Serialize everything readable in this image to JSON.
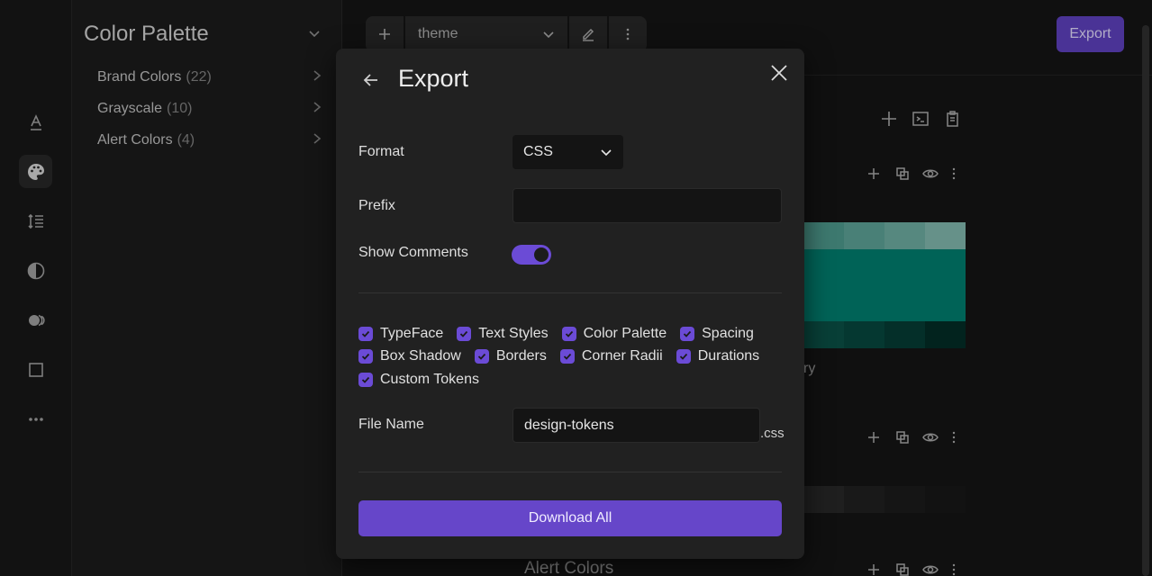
{
  "rail": {
    "icons": [
      "typography-icon",
      "palette-icon",
      "line-height-icon",
      "contrast-icon",
      "shadow-icon",
      "border-square-icon",
      "more-horizontal-icon"
    ]
  },
  "sidebar": {
    "title": "Color Palette",
    "items": [
      {
        "label": "Brand Colors",
        "count": "(22)"
      },
      {
        "label": "Grayscale",
        "count": "(10)"
      },
      {
        "label": "Alert Colors",
        "count": "(4)"
      }
    ]
  },
  "toolbar": {
    "theme_value": "theme",
    "export_label": "Export"
  },
  "background": {
    "partial_label": "ry",
    "section_heading": "Alert Colors",
    "colors": {
      "teal": "#00796b",
      "teal_light": "#4f9a8f",
      "teal_dark": "#0a3c33"
    }
  },
  "modal": {
    "title": "Export",
    "format_label": "Format",
    "format_value": "CSS",
    "prefix_label": "Prefix",
    "prefix_value": "",
    "show_comments_label": "Show Comments",
    "show_comments_on": true,
    "token_checks": [
      [
        "TypeFace",
        "Text Styles",
        "Color Palette",
        "Spacing"
      ],
      [
        "Box Shadow",
        "Borders",
        "Corner Radii",
        "Durations"
      ],
      [
        "Custom Tokens"
      ]
    ],
    "file_name_label": "File Name",
    "file_name_value": "design-tokens",
    "file_suffix": ".css",
    "download_label": "Download All"
  },
  "colors": {
    "accent": "#6b4bd6",
    "export_button": "#5b3fb8"
  }
}
